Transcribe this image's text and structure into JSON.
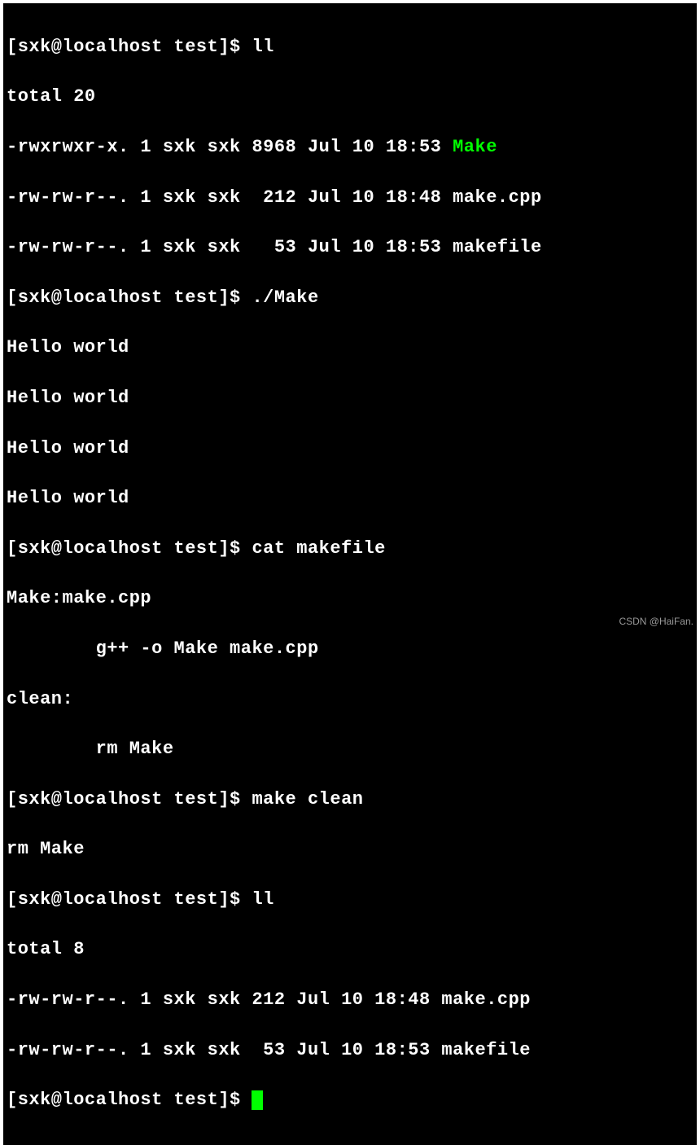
{
  "terminal": {
    "prompt": "[sxk@localhost test]$ ",
    "commands": {
      "ll1": "ll",
      "run_make": "./Make",
      "cat_makefile": "cat makefile",
      "make_clean": "make clean",
      "ll2": "ll"
    },
    "output": {
      "total20": "total 20",
      "ls1_row1_perms": "-rwxrwxr-x. 1 sxk sxk 8968 Jul 10 18:53 ",
      "ls1_row1_name": "Make",
      "ls1_row2": "-rw-rw-r--. 1 sxk sxk  212 Jul 10 18:48 make.cpp",
      "ls1_row3": "-rw-rw-r--. 1 sxk sxk   53 Jul 10 18:53 makefile",
      "hello1": "Hello world",
      "hello2": "Hello world",
      "hello3": "Hello world",
      "hello4": "Hello world",
      "makefile_line1": "Make:make.cpp",
      "makefile_line2": "        g++ -o Make make.cpp",
      "makefile_line3": "clean:",
      "makefile_line4": "        rm Make",
      "rm_make": "rm Make",
      "total8": "total 8",
      "ls2_row1": "-rw-rw-r--. 1 sxk sxk 212 Jul 10 18:48 make.cpp",
      "ls2_row2": "-rw-rw-r--. 1 sxk sxk  53 Jul 10 18:53 makefile"
    }
  },
  "watermark": "CSDN @HaiFan."
}
